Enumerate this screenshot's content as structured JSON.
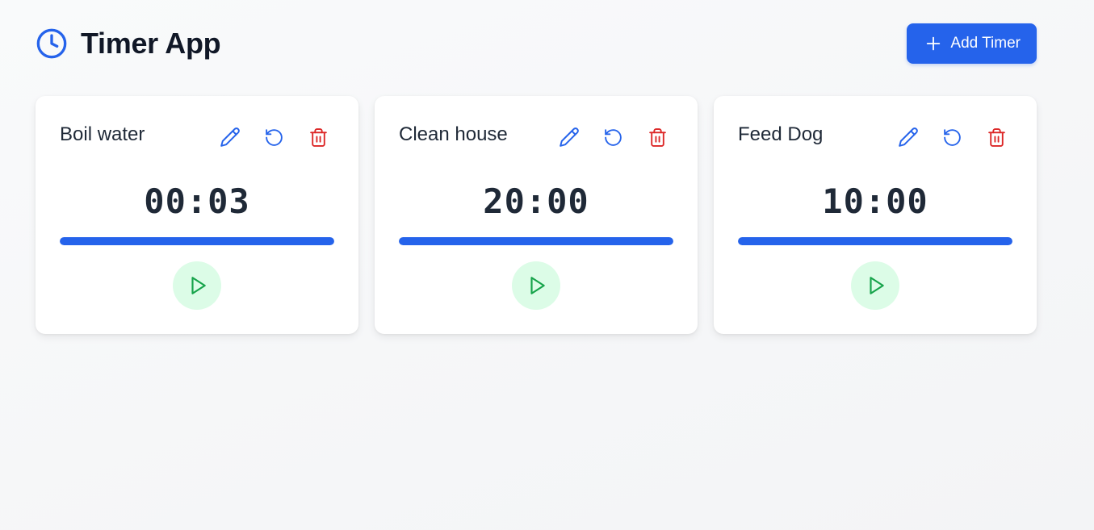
{
  "app": {
    "title": "Timer App",
    "add_button_label": "Add Timer"
  },
  "colors": {
    "accent": "#2563eb",
    "danger": "#dc2626",
    "play_bg": "#dcfce7",
    "play_icon": "#16a34a"
  },
  "timers": [
    {
      "name": "Boil water",
      "time": "00:03",
      "progress": 1.0
    },
    {
      "name": "Clean house",
      "time": "20:00",
      "progress": 1.0
    },
    {
      "name": "Feed Dog",
      "time": "10:00",
      "progress": 1.0
    }
  ],
  "icons": {
    "brand": "clock-icon",
    "add": "plus-icon",
    "edit": "pencil-icon",
    "reset": "rotate-ccw-icon",
    "delete": "trash-icon",
    "play": "play-icon"
  }
}
